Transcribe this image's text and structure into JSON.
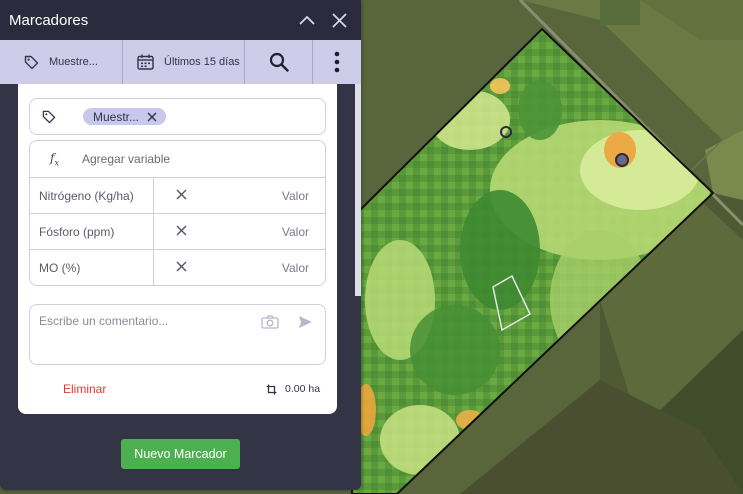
{
  "panel": {
    "title": "Marcadores",
    "toolbar": {
      "filter_label": "Muestre...",
      "date_label": "Últimos 15 días"
    }
  },
  "tags": {
    "chip_label": "Muestr..."
  },
  "variables": {
    "add_label": "Agregar variable",
    "rows": [
      {
        "name": "Nitrógeno (Kg/ha)",
        "value": "",
        "placeholder": "Valor"
      },
      {
        "name": "Fósforo (ppm)",
        "value": "",
        "placeholder": "Valor"
      },
      {
        "name": "MO (%)",
        "value": "",
        "placeholder": "Valor"
      }
    ]
  },
  "comment": {
    "value": "",
    "placeholder": "Escribe un comentario..."
  },
  "footer": {
    "delete_label": "Eliminar",
    "area_label": "0.00 ha"
  },
  "new_marker_button": "Nuevo Marcador",
  "colors": {
    "accent_green": "#4caf50",
    "delete_red": "#e53935",
    "panel_dark": "#343447",
    "toolbar_lavender": "#cdcde9",
    "chip_lavender": "#c8c8ef"
  },
  "icons": [
    "tag-icon",
    "calendar-icon",
    "search-icon",
    "more-vertical-icon",
    "chevron-up-icon",
    "close-icon",
    "camera-icon",
    "send-icon",
    "crop-area-icon",
    "function-icon"
  ]
}
